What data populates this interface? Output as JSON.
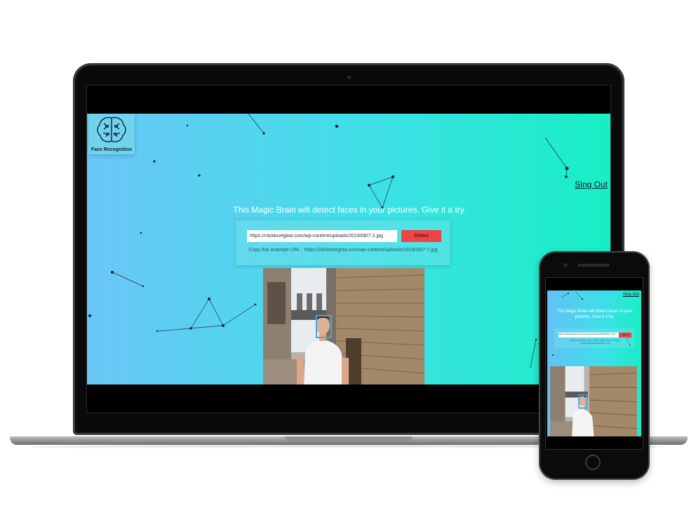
{
  "app": {
    "logo_label": "Face Recognition",
    "signout_label": "Sing Out",
    "headline": "This Magic Brain will detect faces in your pictures. Give it a try",
    "url_input_value": "https://clickloveglow.com/wp-content/uploads/2019/08/7-2.jpg",
    "detect_label": "Detect",
    "example_text": "Copy this example URL : https://clickloveglow.com/wp-content/uploads/2019/08/7-7.jpg",
    "colors": {
      "gradient_start": "#6bc6f7",
      "gradient_end": "#17efc4",
      "detect_button": "#ef4444",
      "face_box": "#4aa3e0"
    }
  },
  "phone_app": {
    "signout_label": "Sing Out",
    "headline": "This Magic Brain will detect faces in your pictures. Give it a try",
    "url_input_value": "https://clickloveglow.com/wp-content/uploads/2019/08/7-2.jpg",
    "detect_label": "Detect",
    "example_text": "Copy this example URL : https://clickloveglow.com/wp-content/uploads/2019/08/7-7.jpg"
  },
  "icons": {
    "logo": "brain-icon"
  }
}
